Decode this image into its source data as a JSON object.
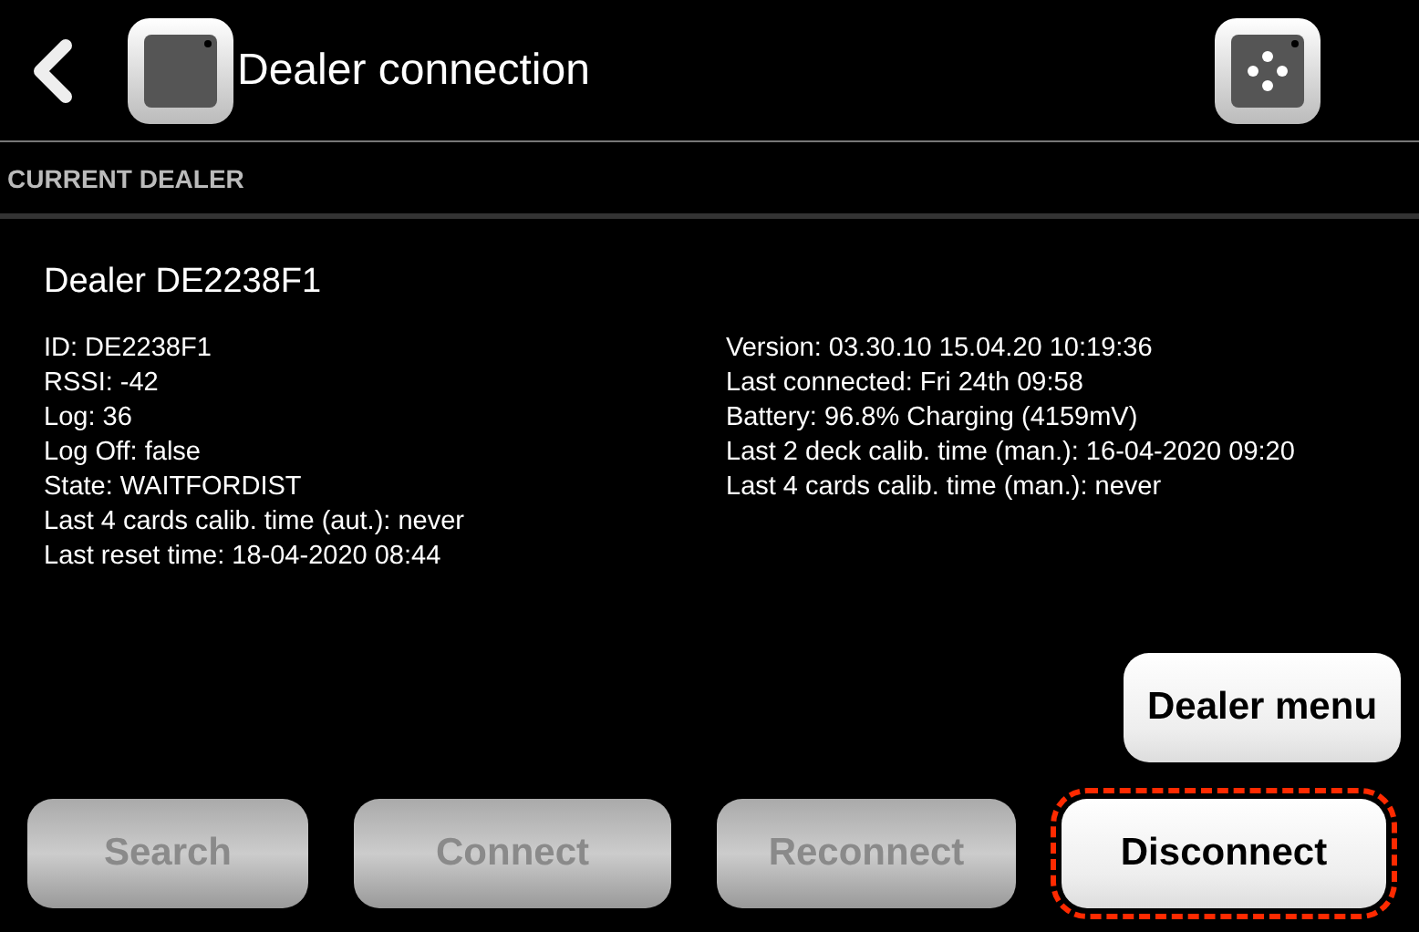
{
  "header": {
    "title": "Dealer connection"
  },
  "section": {
    "title": "CURRENT DEALER"
  },
  "dealer": {
    "name": "Dealer DE2238F1",
    "left_details": [
      "ID: DE2238F1",
      "RSSI: -42",
      "Log: 36",
      "Log Off: false",
      "State: WAITFORDIST",
      "Last 4 cards calib. time (aut.): never",
      "Last reset time: 18-04-2020 08:44"
    ],
    "right_details": [
      "Version: 03.30.10 15.04.20 10:19:36",
      "Last connected: Fri 24th 09:58",
      "Battery: 96.8% Charging (4159mV)",
      "Last 2 deck calib. time (man.): 16-04-2020 09:20",
      "Last 4 cards calib. time (man.): never"
    ]
  },
  "menu_button": {
    "label": "Dealer menu",
    "disabled": false,
    "highlighted": false
  },
  "buttons": [
    {
      "label": "Search",
      "disabled": true,
      "highlighted": false
    },
    {
      "label": "Connect",
      "disabled": true,
      "highlighted": false
    },
    {
      "label": "Reconnect",
      "disabled": true,
      "highlighted": false
    },
    {
      "label": "Disconnect",
      "disabled": false,
      "highlighted": true
    }
  ]
}
